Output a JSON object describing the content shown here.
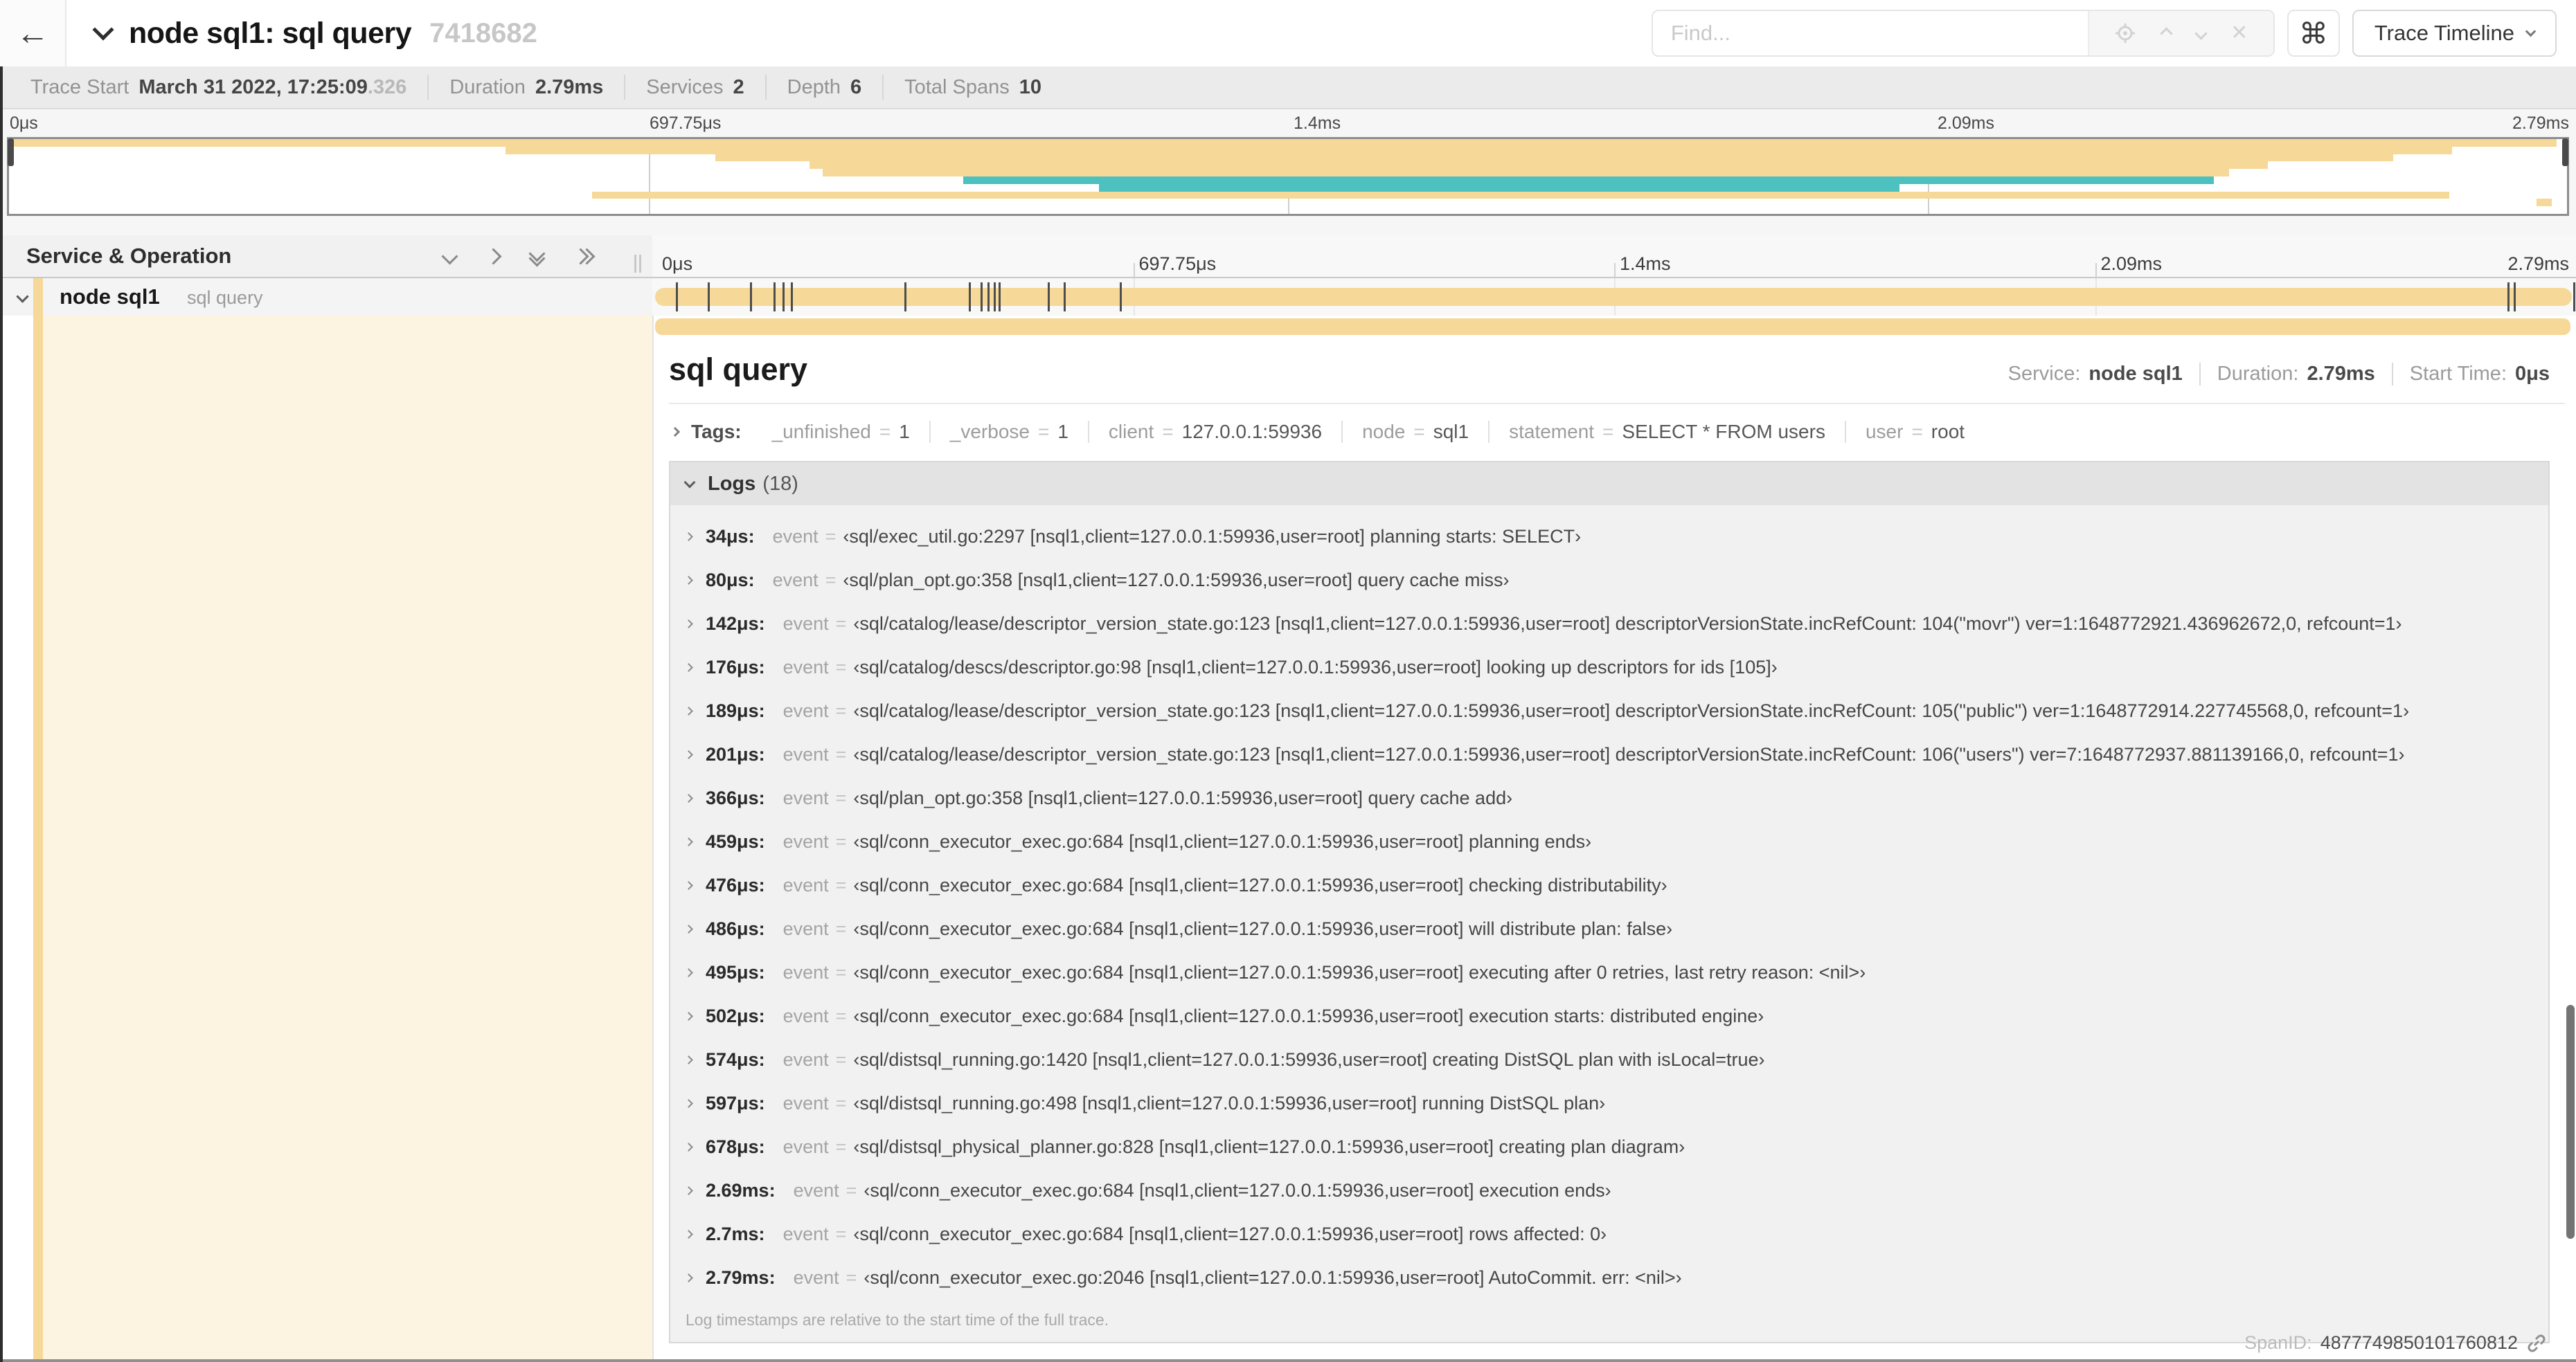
{
  "topbar": {
    "back_icon": "←",
    "title": "node sql1: sql query",
    "trace_id": "7418682",
    "search": {
      "placeholder": "Find...",
      "clear_icon": "✕"
    },
    "shortcut_icon": "⌘",
    "view_selector": "Trace Timeline"
  },
  "stats": {
    "items": [
      {
        "label": "Trace Start",
        "value": "March 31 2022, 17:25:09",
        "extra": ".326"
      },
      {
        "label": "Duration",
        "value": "2.79ms",
        "extra": ""
      },
      {
        "label": "Services",
        "value": "2",
        "extra": ""
      },
      {
        "label": "Depth",
        "value": "6",
        "extra": ""
      },
      {
        "label": "Total Spans",
        "value": "10",
        "extra": ""
      }
    ]
  },
  "ruler_ticks": [
    "0μs",
    "697.75μs",
    "1.4ms",
    "2.09ms",
    "2.79ms"
  ],
  "colors": {
    "span_tan": "#f6d898",
    "span_teal": "#4cc1c0"
  },
  "minimap": {
    "spans": [
      {
        "l": "0%",
        "w": "99.6%",
        "c": "#f6d898"
      },
      {
        "l": "19.4%",
        "w": "76.1%",
        "c": "#f6d898"
      },
      {
        "l": "27.6%",
        "w": "65.6%",
        "c": "#f6d898"
      },
      {
        "l": "31.3%",
        "w": "57%",
        "c": "#f6d898"
      },
      {
        "l": "31.8%",
        "w": "55%",
        "c": "#f6d898"
      },
      {
        "l": "37.3%",
        "w": "48.9%",
        "c": "#4cc1c0"
      },
      {
        "l": "42.6%",
        "w": "31.3%",
        "c": "#4cc1c0"
      },
      {
        "l": "22.8%",
        "w": "72.6%",
        "c": "#f6d898"
      },
      {
        "l": "98.8%",
        "w": "0.6%",
        "c": "#f6d898"
      },
      {
        "l": "0%",
        "w": "0%",
        "c": "transparent"
      }
    ]
  },
  "timeline_header": {
    "title": "Service & Operation"
  },
  "span_row": {
    "service": "node sql1",
    "operation": "sql query",
    "markers": [
      {
        "l": "1.22%"
      },
      {
        "l": "2.87%"
      },
      {
        "l": "5.09%"
      },
      {
        "l": "6.31%"
      },
      {
        "l": "6.77%"
      },
      {
        "l": "7.2%"
      },
      {
        "l": "13.12%"
      },
      {
        "l": "16.45%"
      },
      {
        "l": "17.06%"
      },
      {
        "l": "17.42%"
      },
      {
        "l": "17.74%"
      },
      {
        "l": "17.99%"
      },
      {
        "l": "20.57%"
      },
      {
        "l": "21.4%"
      },
      {
        "l": "24.3%"
      },
      {
        "l": "96.42%"
      },
      {
        "l": "96.77%"
      },
      {
        "l": "99.85%"
      }
    ]
  },
  "detail": {
    "title": "sql query",
    "service_label": "Service:",
    "service": "node sql1",
    "duration_label": "Duration:",
    "duration": "2.79ms",
    "start_label": "Start Time:",
    "start": "0μs",
    "tags_label": "Tags:",
    "eq": "=",
    "tags": [
      {
        "key": "_unfinished",
        "value": "1"
      },
      {
        "key": "_verbose",
        "value": "1"
      },
      {
        "key": "client",
        "value": "127.0.0.1:59936"
      },
      {
        "key": "node",
        "value": "sql1"
      },
      {
        "key": "statement",
        "value": "SELECT * FROM users"
      },
      {
        "key": "user",
        "value": "root"
      }
    ],
    "logs_label": "Logs",
    "logs_count": "(18)",
    "log_key": "event",
    "logs": [
      {
        "t": "34μs:",
        "v": "‹sql/exec_util.go:2297 [nsql1,client=127.0.0.1:59936,user=root] planning starts: SELECT›"
      },
      {
        "t": "80μs:",
        "v": "‹sql/plan_opt.go:358 [nsql1,client=127.0.0.1:59936,user=root] query cache miss›"
      },
      {
        "t": "142μs:",
        "v": "‹sql/catalog/lease/descriptor_version_state.go:123 [nsql1,client=127.0.0.1:59936,user=root] descriptorVersionState.incRefCount: 104(\"movr\") ver=1:1648772921.436962672,0, refcount=1›"
      },
      {
        "t": "176μs:",
        "v": "‹sql/catalog/descs/descriptor.go:98 [nsql1,client=127.0.0.1:59936,user=root] looking up descriptors for ids [105]›"
      },
      {
        "t": "189μs:",
        "v": "‹sql/catalog/lease/descriptor_version_state.go:123 [nsql1,client=127.0.0.1:59936,user=root] descriptorVersionState.incRefCount: 105(\"public\") ver=1:1648772914.227745568,0, refcount=1›"
      },
      {
        "t": "201μs:",
        "v": "‹sql/catalog/lease/descriptor_version_state.go:123 [nsql1,client=127.0.0.1:59936,user=root] descriptorVersionState.incRefCount: 106(\"users\") ver=7:1648772937.881139166,0, refcount=1›"
      },
      {
        "t": "366μs:",
        "v": "‹sql/plan_opt.go:358 [nsql1,client=127.0.0.1:59936,user=root] query cache add›"
      },
      {
        "t": "459μs:",
        "v": "‹sql/conn_executor_exec.go:684 [nsql1,client=127.0.0.1:59936,user=root] planning ends›"
      },
      {
        "t": "476μs:",
        "v": "‹sql/conn_executor_exec.go:684 [nsql1,client=127.0.0.1:59936,user=root] checking distributability›"
      },
      {
        "t": "486μs:",
        "v": "‹sql/conn_executor_exec.go:684 [nsql1,client=127.0.0.1:59936,user=root] will distribute plan: false›"
      },
      {
        "t": "495μs:",
        "v": "‹sql/conn_executor_exec.go:684 [nsql1,client=127.0.0.1:59936,user=root] executing after 0 retries, last retry reason: <nil>›"
      },
      {
        "t": "502μs:",
        "v": "‹sql/conn_executor_exec.go:684 [nsql1,client=127.0.0.1:59936,user=root] execution starts: distributed engine›"
      },
      {
        "t": "574μs:",
        "v": "‹sql/distsql_running.go:1420 [nsql1,client=127.0.0.1:59936,user=root] creating DistSQL plan with isLocal=true›"
      },
      {
        "t": "597μs:",
        "v": "‹sql/distsql_running.go:498 [nsql1,client=127.0.0.1:59936,user=root] running DistSQL plan›"
      },
      {
        "t": "678μs:",
        "v": "‹sql/distsql_physical_planner.go:828 [nsql1,client=127.0.0.1:59936,user=root] creating plan diagram›"
      },
      {
        "t": "2.69ms:",
        "v": "‹sql/conn_executor_exec.go:684 [nsql1,client=127.0.0.1:59936,user=root] execution ends›"
      },
      {
        "t": "2.7ms:",
        "v": "‹sql/conn_executor_exec.go:684 [nsql1,client=127.0.0.1:59936,user=root] rows affected: 0›"
      },
      {
        "t": "2.79ms:",
        "v": "‹sql/conn_executor_exec.go:2046 [nsql1,client=127.0.0.1:59936,user=root] AutoCommit. err: <nil>›"
      }
    ],
    "footnote": "Log timestamps are relative to the start time of the full trace.",
    "spanid_label": "SpanID:",
    "spanid": "4877749850101760812"
  }
}
